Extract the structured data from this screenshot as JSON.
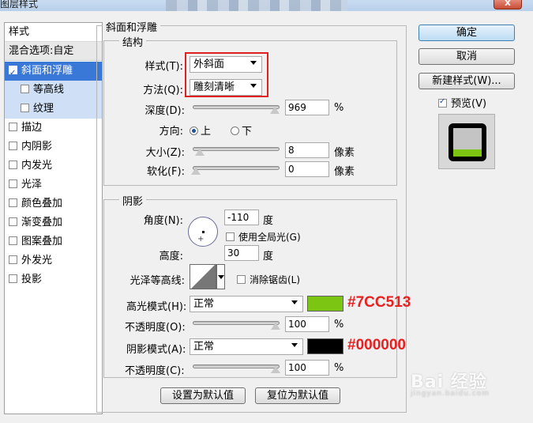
{
  "window": {
    "title": "图层样式",
    "close": "X"
  },
  "left_list": {
    "header": "样式",
    "blend_options": "混合选项:自定",
    "items": [
      {
        "label": "斜面和浮雕",
        "checked": true,
        "selected": true
      },
      {
        "label": "等高线",
        "checked": false,
        "sub": true
      },
      {
        "label": "纹理",
        "checked": false,
        "sub": true
      },
      {
        "label": "描边",
        "checked": false
      },
      {
        "label": "内阴影",
        "checked": false
      },
      {
        "label": "内发光",
        "checked": false
      },
      {
        "label": "光泽",
        "checked": false
      },
      {
        "label": "颜色叠加",
        "checked": false
      },
      {
        "label": "渐变叠加",
        "checked": false
      },
      {
        "label": "图案叠加",
        "checked": false
      },
      {
        "label": "外发光",
        "checked": false
      },
      {
        "label": "投影",
        "checked": false
      }
    ]
  },
  "bevel": {
    "title": "斜面和浮雕",
    "structure": {
      "title": "结构",
      "style_label": "样式(T):",
      "style_value": "外斜面",
      "technique_label": "方法(Q):",
      "technique_value": "雕刻清晰",
      "depth_label": "深度(D):",
      "depth_value": "969",
      "depth_unit": "%",
      "direction_label": "方向:",
      "direction_up": "上",
      "direction_down": "下",
      "size_label": "大小(Z):",
      "size_value": "8",
      "size_unit": "像素",
      "soften_label": "软化(F):",
      "soften_value": "0",
      "soften_unit": "像素"
    },
    "shading": {
      "title": "阴影",
      "angle_label": "角度(N):",
      "angle_value": "-110",
      "angle_unit": "度",
      "global_light": "使用全局光(G)",
      "altitude_label": "高度:",
      "altitude_value": "30",
      "altitude_unit": "度",
      "gloss_label": "光泽等高线:",
      "anti_alias": "消除锯齿(L)",
      "highlight_label": "高光模式(H):",
      "highlight_mode": "正常",
      "highlight_color": "#7CC513",
      "highlight_annotation": "#7CC513",
      "opacity1_label": "不透明度(O):",
      "opacity1_value": "100",
      "opacity1_unit": "%",
      "shadow_label": "阴影模式(A):",
      "shadow_mode": "正常",
      "shadow_color": "#000000",
      "shadow_annotation": "#000000",
      "opacity2_label": "不透明度(C):",
      "opacity2_value": "100",
      "opacity2_unit": "%"
    },
    "make_default": "设置为默认值",
    "reset_default": "复位为默认值"
  },
  "right": {
    "ok": "确定",
    "cancel": "取消",
    "new_style": "新建样式(W)...",
    "preview": "预览(V)"
  },
  "watermark": {
    "brand": "Bai 经验",
    "url": "jingyan.baidu.com"
  }
}
